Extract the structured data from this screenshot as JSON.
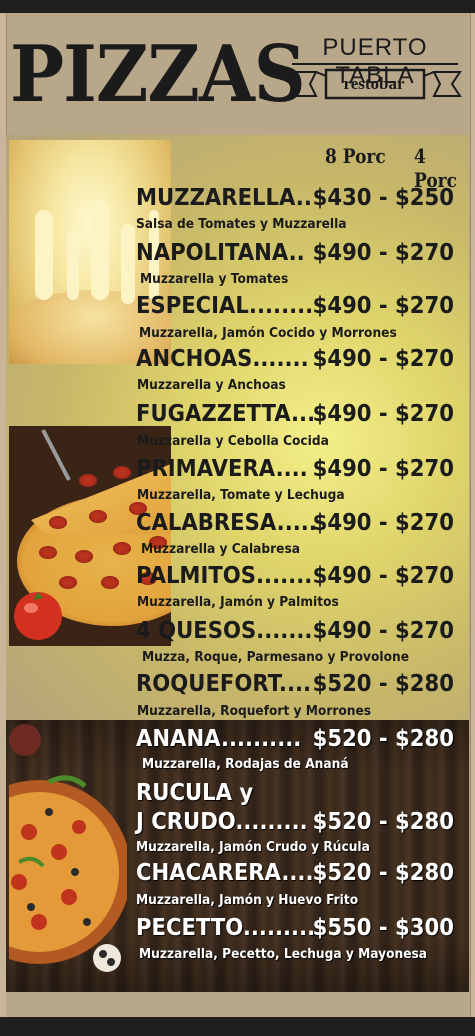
{
  "title": "PIZZAS",
  "brand": {
    "name": "PUERTO TABLA",
    "sub": "restobar"
  },
  "size_headers": [
    "8 Porc",
    "4 Porc"
  ],
  "items": [
    {
      "name": "MUZZARELLA..",
      "price": "$430 - $250",
      "desc": "Salsa de Tomates y Muzzarella"
    },
    {
      "name": "NAPOLITANA..",
      "price": "$490 - $270",
      "desc": "Muzzarella y Tomates"
    },
    {
      "name": "ESPECIAL........",
      "price": "$490 - $270",
      "desc": "Muzzarella, Jamón Cocido y Morrones"
    },
    {
      "name": "ANCHOAS.......",
      "price": "$490 - $270",
      "desc": "Muzzarella y Anchoas"
    },
    {
      "name": "FUGAZZETTA...",
      "price": "$490 - $270",
      "desc": "Muzzarella y Cebolla Cocida"
    },
    {
      "name": "PRIMAVERA....",
      "price": "$490 - $270",
      "desc": "Muzzarella, Tomate y Lechuga"
    },
    {
      "name": "CALABRESA.....",
      "price": "$490 - $270",
      "desc": "Muzzarella y Calabresa"
    },
    {
      "name": "PALMITOS.......",
      "price": "$490 - $270",
      "desc": "Muzzarella, Jamón y Palmitos"
    },
    {
      "name": "4 QUESOS.......",
      "price": "$490 - $270",
      "desc": "Muzza, Roque, Parmesano y Provolone"
    },
    {
      "name": "ROQUEFORT....",
      "price": "$520 - $280",
      "desc": "Muzzarella, Roquefort y Morrones"
    },
    {
      "name": "ANANA..........",
      "price": "$520 - $280",
      "desc": "Muzzarella, Rodajas de Ananá"
    },
    {
      "name_line1": "RUCULA y",
      "name": "J CRUDO.........",
      "price": "$520 - $280",
      "desc": "Muzzarella, Jamón Crudo y Rúcula"
    },
    {
      "name": "CHACARERA....",
      "price": "$520 - $280",
      "desc": "Muzzarella, Jamón y Huevo Frito"
    },
    {
      "name": "PECETTO.........",
      "price": "$550 - $300",
      "desc": "Muzzarella, Pecetto, Lechuga y Mayonesa"
    }
  ],
  "colors": {
    "background": "#b9a78a",
    "highlight": "#f4ef8a",
    "wood": "#3b2a1e",
    "text_dark": "#1b1b1b",
    "text_light": "#ffffff"
  },
  "images": [
    "cheese-pizza-photo",
    "pepperoni-pizza-photo",
    "pizza-on-wood-photo"
  ]
}
